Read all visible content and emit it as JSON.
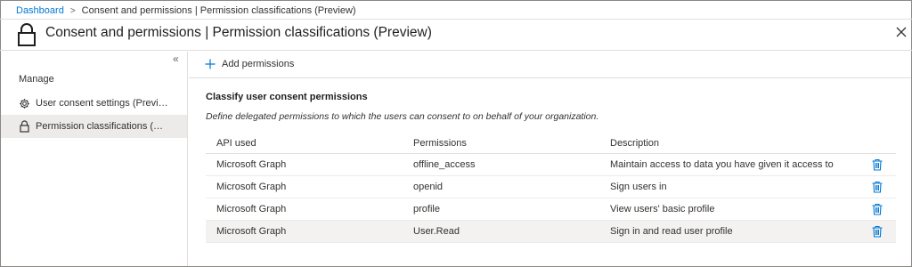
{
  "breadcrumb": {
    "home": "Dashboard",
    "current": "Consent and permissions | Permission classifications (Preview)"
  },
  "header": {
    "title": "Consent and permissions | Permission classifications (Preview)",
    "icon": "lock-icon"
  },
  "sidebar": {
    "section_label": "Manage",
    "items": [
      {
        "label": "User consent settings (Preview)",
        "icon": "gear-icon",
        "selected": false
      },
      {
        "label": "Permission classifications (Previ...",
        "icon": "lock-icon",
        "selected": true
      }
    ]
  },
  "toolbar": {
    "add_label": "Add permissions"
  },
  "main": {
    "title": "Classify user consent permissions",
    "description": "Define delegated permissions to which the users can consent to on behalf of your organization."
  },
  "table": {
    "headers": [
      "API used",
      "Permissions",
      "Description"
    ],
    "rows": [
      {
        "api": "Microsoft Graph",
        "permission": "offline_access",
        "description": "Maintain access to data you have given it access to"
      },
      {
        "api": "Microsoft Graph",
        "permission": "openid",
        "description": "Sign users in"
      },
      {
        "api": "Microsoft Graph",
        "permission": "profile",
        "description": "View users' basic profile"
      },
      {
        "api": "Microsoft Graph",
        "permission": "User.Read",
        "description": "Sign in and read user profile",
        "highlighted": true
      }
    ]
  },
  "colors": {
    "accent": "#0078d4",
    "selected_bg": "#edebe9",
    "hover_bg": "#f3f2f1"
  }
}
